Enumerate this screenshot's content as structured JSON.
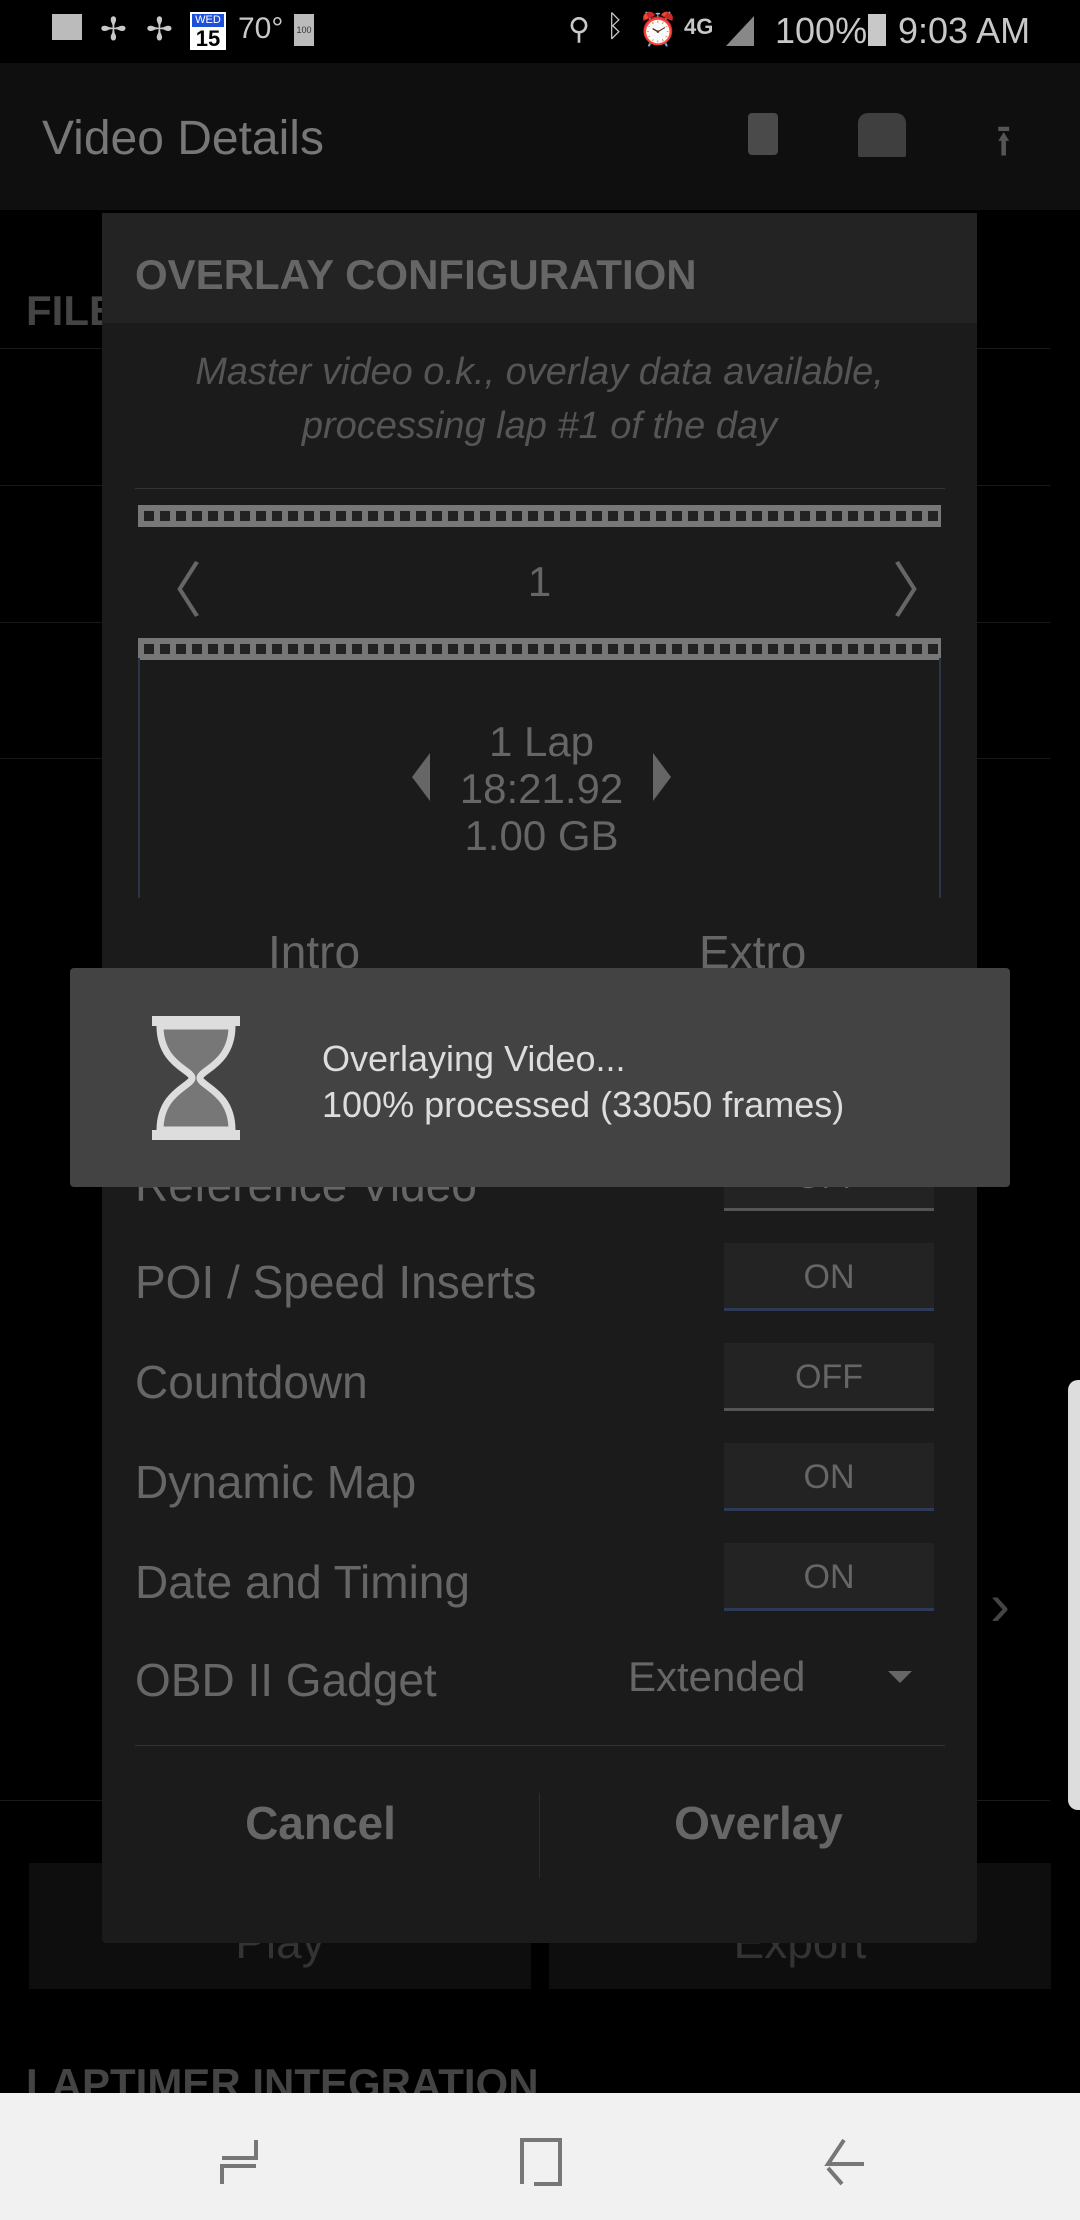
{
  "status_bar": {
    "date_day": "WED",
    "date_num": "15",
    "temperature": "70°",
    "battery_small": "100",
    "network": "4G",
    "battery": "100%",
    "time": "9:03 AM"
  },
  "app_bar": {
    "title": "Video Details",
    "icons": [
      "trash-icon",
      "video-camera-icon",
      "upload-icon"
    ]
  },
  "background": {
    "section_file": "FILE",
    "play_label": "Play",
    "export_label": "Export",
    "section_laptimer": "LAPTIMER INTEGRATION"
  },
  "dialog": {
    "title": "OVERLAY CONFIGURATION",
    "subtitle_line1": "Master video o.k., overlay data available,",
    "subtitle_line2": "processing lap #1 of the day",
    "lap_number": "1",
    "lap_count": "1 Lap",
    "lap_time": "18:21.92",
    "lap_size": "1.00 GB",
    "intro_label": "Intro",
    "extro_label": "Extro",
    "options": [
      {
        "label": "Reference Video",
        "value": "OFF"
      },
      {
        "label": "POI / Speed Inserts",
        "value": "ON"
      },
      {
        "label": "Countdown",
        "value": "OFF"
      },
      {
        "label": "Dynamic Map",
        "value": "ON"
      },
      {
        "label": "Date and Timing",
        "value": "ON"
      }
    ],
    "obd_label": "OBD II Gadget",
    "obd_value": "Extended",
    "cancel_label": "Cancel",
    "overlay_label": "Overlay"
  },
  "toast": {
    "line1": "Overlaying Video...",
    "line2": "100% processed (33050 frames)",
    "progress_percent": 100,
    "icon": "hourglass-icon"
  }
}
